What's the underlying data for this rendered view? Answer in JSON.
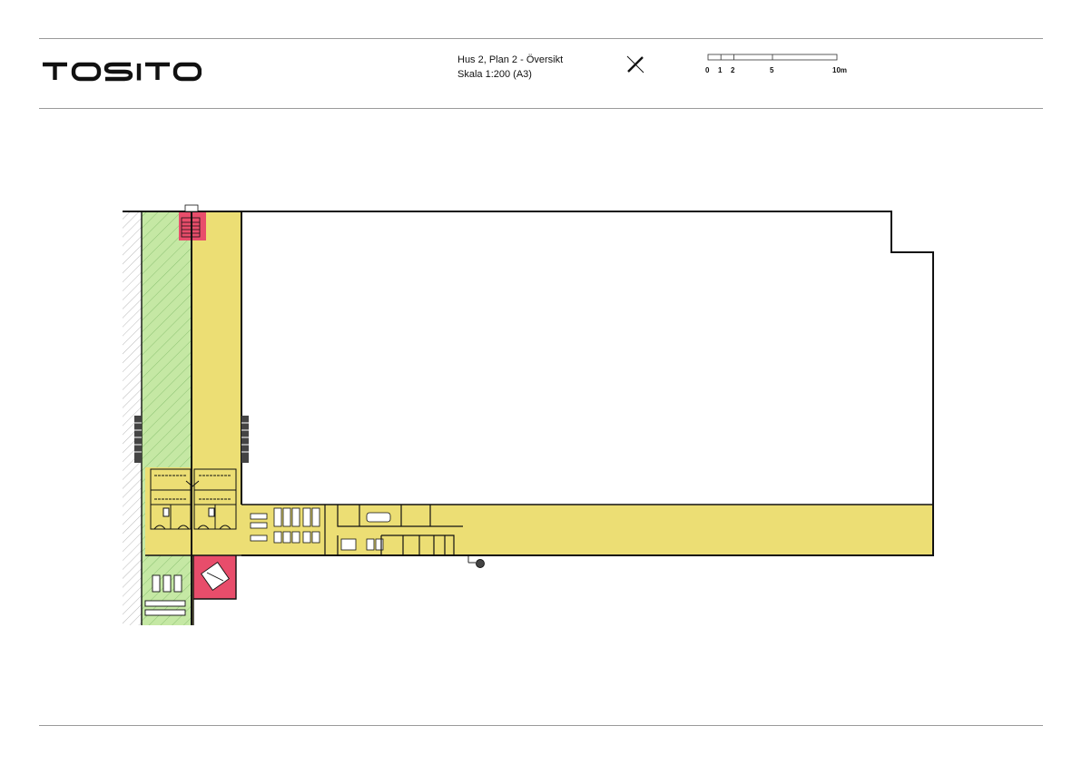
{
  "brand": {
    "logo_text": "TOSITO"
  },
  "drawing": {
    "title": "Hus 2, Plan 2 - Översikt",
    "scale": "Skala 1:200 (A3)"
  },
  "scale_bar": {
    "labels": [
      "0",
      "1",
      "2",
      "5",
      "10m"
    ]
  },
  "colors": {
    "office_yellow": "#ECDE74",
    "green_zone": "#C5E8A4",
    "stair_red": "#E84D6B",
    "lines": "#111111"
  }
}
